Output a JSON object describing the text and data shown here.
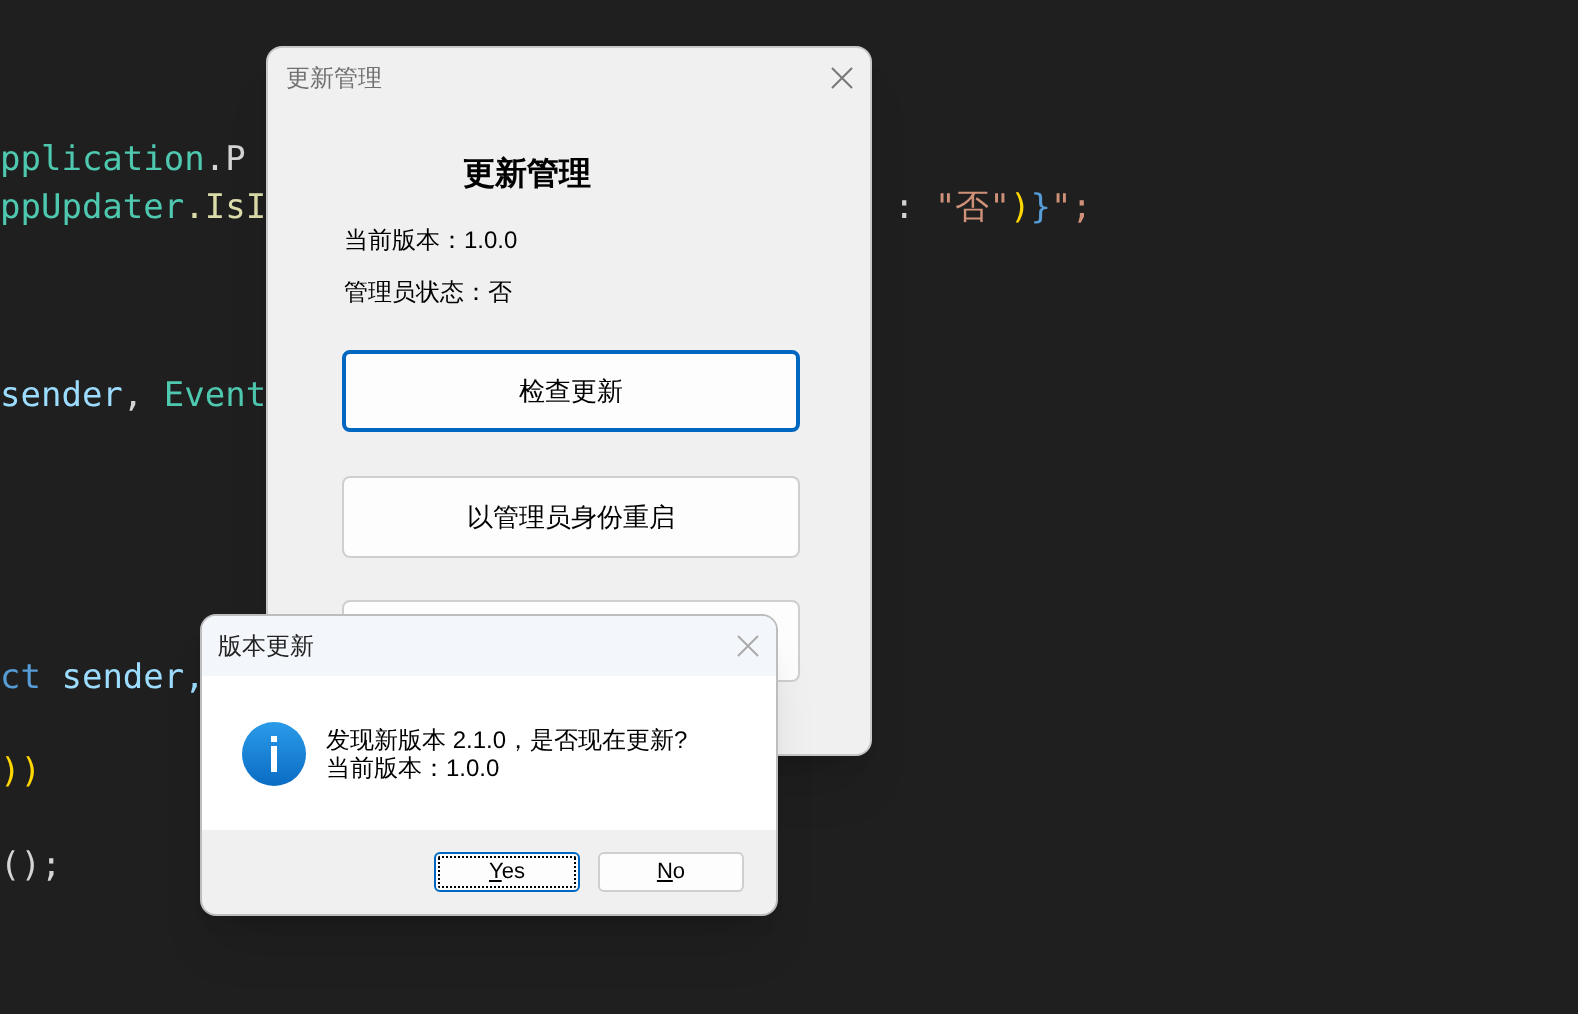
{
  "editor": {
    "lines": [
      {
        "tokens": [
          {
            "text": "pplication",
            "color": "#4ec9b0"
          },
          {
            "text": ".P",
            "color": "#d4d4d4"
          }
        ]
      },
      {
        "tokens": [
          {
            "text": "ppUpdater",
            "color": "#4ec9b0"
          },
          {
            "text": ".IsI",
            "color": "#dcdcaa"
          }
        ]
      },
      {
        "tokens": [
          {
            "text": "sender",
            "color": "#9cdcfe"
          },
          {
            "text": ", ",
            "color": "#d4d4d4"
          },
          {
            "text": "Event",
            "color": "#4ec9b0"
          }
        ]
      },
      {
        "tokens": [
          {
            "text": "ct",
            "color": "#569cd6"
          },
          {
            "text": " sender,",
            "color": "#9cdcfe"
          }
        ]
      },
      {
        "tokens": [
          {
            "text": "))",
            "color": "#ffd700"
          }
        ]
      },
      {
        "tokens": [
          {
            "text": "();",
            "color": "#d4d4d4"
          }
        ]
      }
    ],
    "right_fragment": [
      {
        "text": ": ",
        "color": "#d4d4d4"
      },
      {
        "text": "\"否\"",
        "color": "#ce9178"
      },
      {
        "text": ")",
        "color": "#ffd700"
      },
      {
        "text": "}",
        "color": "#569cd6"
      },
      {
        "text": "\";",
        "color": "#ce9178"
      }
    ]
  },
  "main_window": {
    "title": "更新管理",
    "heading": "更新管理",
    "info": [
      "当前版本：1.0.0",
      "管理员状态：否"
    ],
    "buttons": [
      {
        "label": "检查更新",
        "focused": true
      },
      {
        "label": "以管理员身份重启",
        "focused": false
      }
    ]
  },
  "dialog": {
    "title": "版本更新",
    "message": [
      "发现新版本 2.1.0，是否现在更新?",
      "当前版本：1.0.0"
    ],
    "buttons": [
      {
        "label": "Yes",
        "focused": true,
        "underline_first": true
      },
      {
        "label": "No",
        "focused": false,
        "underline_first": true
      }
    ]
  }
}
